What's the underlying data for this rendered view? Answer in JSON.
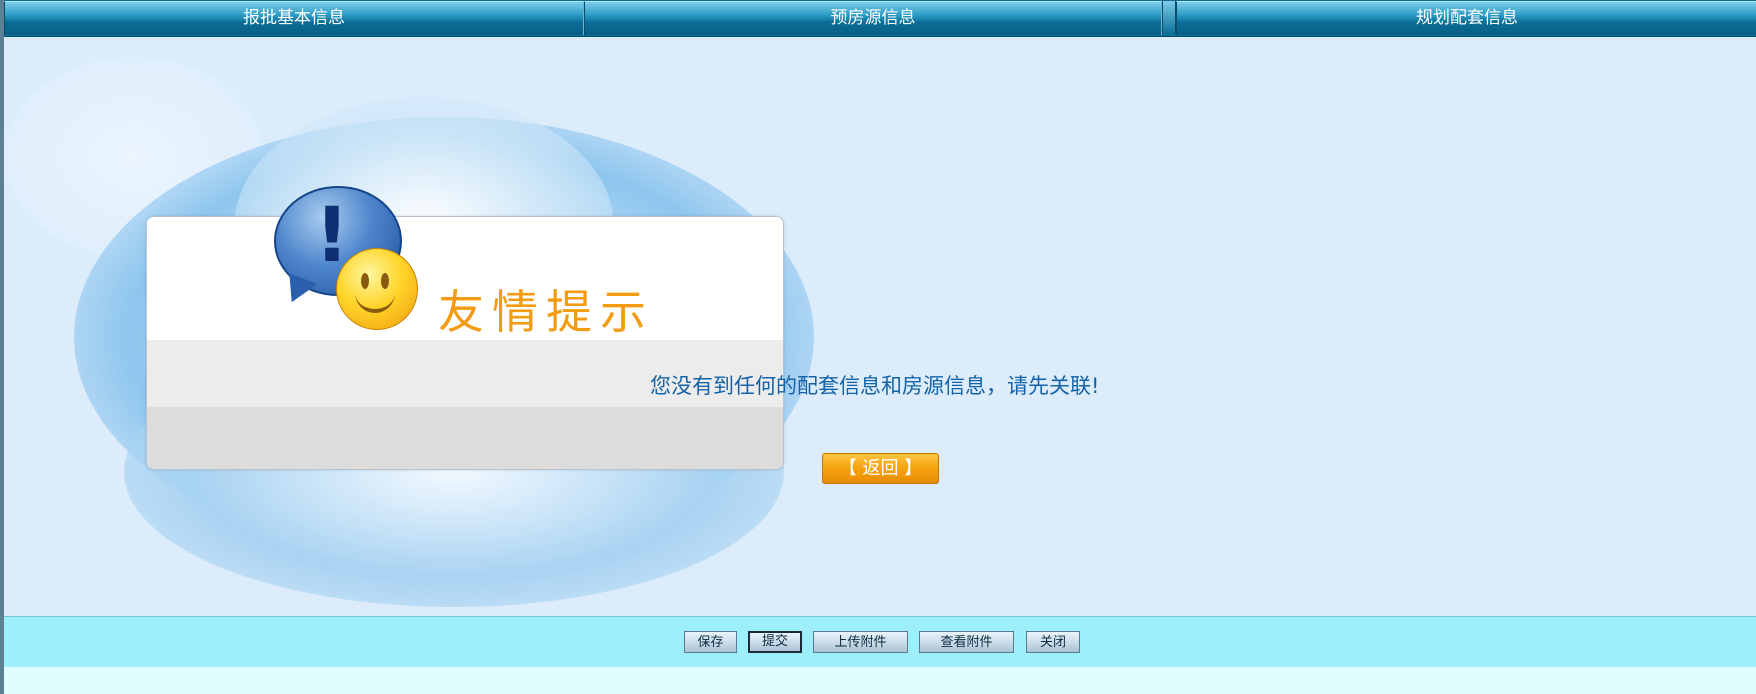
{
  "tabs": [
    {
      "label": "报批基本信息"
    },
    {
      "label": "预房源信息"
    },
    {
      "label": "规划配套信息"
    }
  ],
  "dialog": {
    "title": "友情提示",
    "message": "您没有到任何的配套信息和房源信息，请先关联!",
    "back_button": "【 返回 】",
    "icons": [
      "exclamation-bubble-icon",
      "smiley-face-icon"
    ]
  },
  "toolbar": {
    "save": "保存",
    "submit": "提交",
    "upload_attachment": "上传附件",
    "view_attachment": "查看附件",
    "close": "关闭"
  },
  "colors": {
    "tab_bar": "#0d6d95",
    "title_orange": "#f39b12",
    "message_blue": "#1463a8",
    "toolbar_bg": "#9deffc",
    "back_button": "#f5a20f"
  }
}
